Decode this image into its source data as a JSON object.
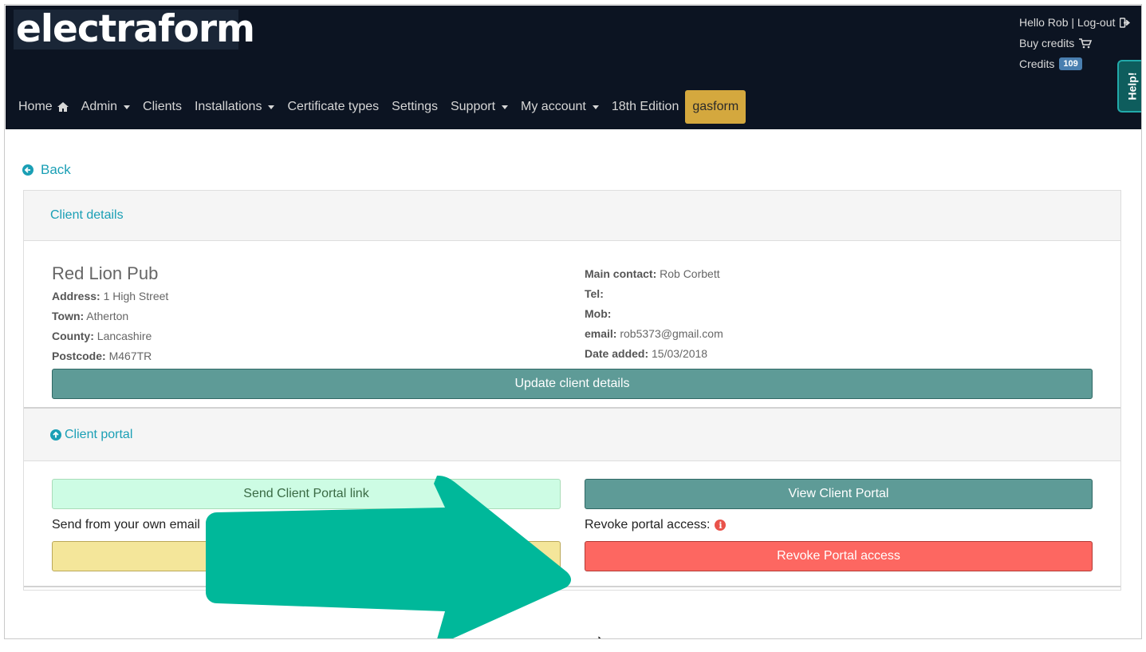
{
  "header": {
    "logo": "electraform",
    "user": {
      "greeting": "Hello Rob | Log-out",
      "buy_credits": "Buy credits",
      "credits_label": "Credits",
      "credits_count": "109"
    },
    "nav": [
      {
        "label": "Home",
        "icon": "home-icon"
      },
      {
        "label": "Admin",
        "dropdown": true
      },
      {
        "label": "Clients"
      },
      {
        "label": "Installations",
        "dropdown": true
      },
      {
        "label": "Certificate types"
      },
      {
        "label": "Settings"
      },
      {
        "label": "Support",
        "dropdown": true
      },
      {
        "label": "My account",
        "dropdown": true
      },
      {
        "label": "18th Edition"
      },
      {
        "label": "gasform"
      }
    ],
    "help": "Help!"
  },
  "back": "Back",
  "client_details": {
    "heading": "Client details",
    "name": "Red Lion Pub",
    "address_label": "Address:",
    "address": "1 High Street",
    "town_label": "Town:",
    "town": "Atherton",
    "county_label": "County:",
    "county": "Lancashire",
    "postcode_label": "Postcode:",
    "postcode": "M467TR",
    "main_contact_label": "Main contact:",
    "main_contact": "Rob Corbett",
    "tel_label": "Tel:",
    "tel": "",
    "mob_label": "Mob:",
    "mob": "",
    "email_label": "email:",
    "email": "rob5373@gmail.com",
    "date_added_label": "Date added:",
    "date_added": "15/03/2018",
    "update_button": "Update client details"
  },
  "client_portal": {
    "heading": "Client portal",
    "send_link_button": "Send Client Portal link",
    "view_portal_button": "View Client Portal",
    "send_own_email_label": "Send from your own email",
    "revoke_label": "Revoke portal access:",
    "revoke_button": "Revoke Portal access"
  },
  "colors": {
    "header_bg": "#0c1422",
    "accent": "#1a9fb5",
    "teal_button": "#5e9b97",
    "revoke_button": "#fd6761",
    "send_button": "#cdfce4",
    "gasform_tab": "#d4a83e",
    "arrow": "#00b89a"
  }
}
